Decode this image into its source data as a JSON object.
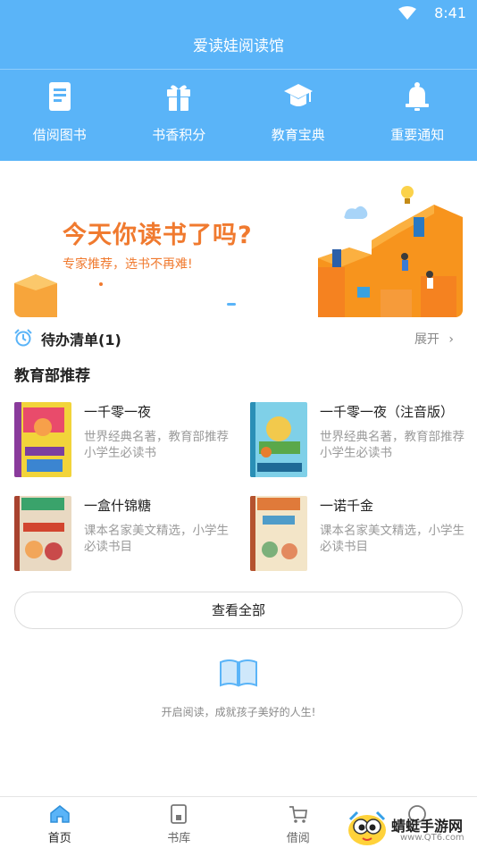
{
  "status": {
    "time": "8:41"
  },
  "app": {
    "title": "爱读娃阅读馆"
  },
  "quick_nav": [
    {
      "label": "借阅图书",
      "icon": "book-icon"
    },
    {
      "label": "书香积分",
      "icon": "gift-icon"
    },
    {
      "label": "教育宝典",
      "icon": "graduation-cap-icon"
    },
    {
      "label": "重要通知",
      "icon": "bell-icon"
    }
  ],
  "banner": {
    "headline": "今天你读书了吗?",
    "subtitle": "专家推荐，选书不再难!"
  },
  "todo": {
    "title": "待办清单(1)",
    "expand_label": "展开"
  },
  "recommend": {
    "section_title": "教育部推荐",
    "books": [
      {
        "title": "一千零一夜",
        "desc": "世界经典名著，教育部推荐小学生必读书"
      },
      {
        "title": "一千零一夜（注音版）",
        "desc": "世界经典名著，教育部推荐小学生必读书"
      },
      {
        "title": "一盒什锦糖",
        "desc": "课本名家美文精选，小学生必读书目"
      },
      {
        "title": "一诺千金",
        "desc": "课本名家美文精选，小学生必读书目"
      }
    ],
    "view_all_label": "查看全部"
  },
  "empty_state": {
    "text": "开启阅读，成就孩子美好的人生!"
  },
  "tabs": [
    {
      "label": "首页",
      "icon": "home-icon",
      "active": true
    },
    {
      "label": "书库",
      "icon": "library-icon",
      "active": false
    },
    {
      "label": "借阅",
      "icon": "cart-icon",
      "active": false
    },
    {
      "label": "",
      "icon": "profile-icon",
      "active": false
    }
  ],
  "watermark": {
    "title": "蜻蜓手游网",
    "url": "www.QT6.com"
  },
  "colors": {
    "primary": "#5ab4f8",
    "accent": "#f07a2f"
  }
}
